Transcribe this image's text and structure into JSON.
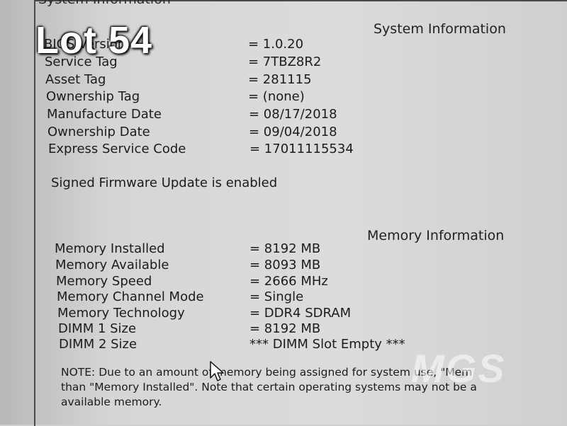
{
  "window": {
    "title": "System Information"
  },
  "system_info": {
    "heading": "System Information",
    "rows": [
      {
        "label": "BIOS Version",
        "value": "= 1.0.20"
      },
      {
        "label": "Service Tag",
        "value": "= 7TBZ8R2"
      },
      {
        "label": "Asset Tag",
        "value": "= 281115"
      },
      {
        "label": "Ownership Tag",
        "value": "= (none)"
      },
      {
        "label": "Manufacture Date",
        "value": "= 08/17/2018"
      },
      {
        "label": "Ownership Date",
        "value": "= 09/04/2018"
      },
      {
        "label": "Express Service Code",
        "value": "= 17011115534"
      }
    ],
    "firmware_status": "Signed Firmware Update is enabled"
  },
  "memory_info": {
    "heading": "Memory Information",
    "rows": [
      {
        "label": "Memory Installed",
        "value": "= 8192 MB"
      },
      {
        "label": "Memory Available",
        "value": "= 8093 MB"
      },
      {
        "label": "Memory Speed",
        "value": "= 2666 MHz"
      },
      {
        "label": "Memory Channel Mode",
        "value": "= Single"
      },
      {
        "label": "Memory Technology",
        "value": "= DDR4 SDRAM"
      },
      {
        "label": "DIMM 1 Size",
        "value": "= 8192 MB"
      },
      {
        "label": "DIMM 2 Size",
        "value": "*** DIMM Slot Empty ***"
      }
    ]
  },
  "note": {
    "line1": "NOTE: Due to an amount of memory being assigned for system use, \"Mem",
    "line2": "than \"Memory Installed\". Note that certain operating systems may not be a",
    "line3": "available memory."
  },
  "overlay": {
    "lot_label": "Lot 54",
    "watermark": "MGS"
  }
}
